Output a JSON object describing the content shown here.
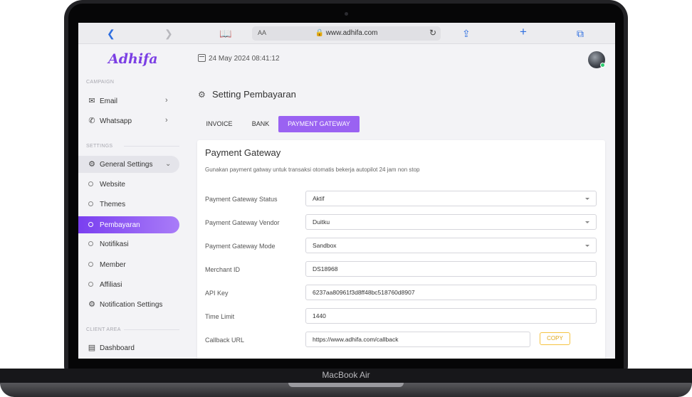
{
  "device": {
    "label": "MacBook Air"
  },
  "browser": {
    "url": "www.adhifa.com",
    "text_size_label": "AA",
    "back_icon": "chevron-left-icon",
    "forward_icon": "chevron-right-icon",
    "bookmarks_icon": "book-icon",
    "share_icon": "share-icon",
    "new_tab_icon": "plus-icon",
    "tabs_icon": "tabs-icon"
  },
  "header": {
    "logo": "Adhifa",
    "datetime": "24 May 2024 08:41:12"
  },
  "sidebar": {
    "sections": {
      "campaign": "CAMPAIGN",
      "settings": "SETTINGS",
      "client_area": "CLIENT AREA"
    },
    "campaign_items": [
      {
        "label": "Email",
        "icon": "mail-icon"
      },
      {
        "label": "Whatsapp",
        "icon": "whatsapp-icon"
      }
    ],
    "general_settings": {
      "label": "General Settings",
      "icon": "gear-icon"
    },
    "sub_items": [
      {
        "label": "Website"
      },
      {
        "label": "Themes"
      },
      {
        "label": "Pembayaran",
        "active": true
      },
      {
        "label": "Notifikasi"
      },
      {
        "label": "Member"
      },
      {
        "label": "Affiliasi"
      }
    ],
    "notification_settings": {
      "label": "Notification Settings",
      "icon": "gear-icon"
    },
    "client_items": [
      {
        "label": "Dashboard",
        "icon": "dashboard-icon"
      }
    ]
  },
  "main": {
    "page_title": "Setting Pembayaran",
    "tabs": [
      {
        "label": "INVOICE"
      },
      {
        "label": "BANK"
      },
      {
        "label": "PAYMENT GATEWAY",
        "active": true
      }
    ],
    "card": {
      "title": "Payment Gateway",
      "description": "Gunakan payment gatway untuk transaksi otomatis bekerja autopilot 24 jam non stop",
      "fields": [
        {
          "label": "Payment Gateway Status",
          "value": "Aktif",
          "type": "select"
        },
        {
          "label": "Payment Gateway Vendor",
          "value": "Duitku",
          "type": "select"
        },
        {
          "label": "Payment Gateway Mode",
          "value": "Sandbox",
          "type": "select"
        },
        {
          "label": "Merchant ID",
          "value": "DS18968",
          "type": "text"
        },
        {
          "label": "API Key",
          "value": "6237aa80961f3d8ff48bc518760d8907",
          "type": "text"
        },
        {
          "label": "Time Limit",
          "value": "1440",
          "type": "text"
        },
        {
          "label": "Callback URL",
          "value": "https://www.adhifa.com/callback",
          "type": "text"
        }
      ],
      "copy_label": "COPY"
    }
  },
  "colors": {
    "accent": "#7b3fe4",
    "tab_active": "#9a62f2",
    "copy_border": "#f5c341",
    "online": "#2ecc71"
  }
}
